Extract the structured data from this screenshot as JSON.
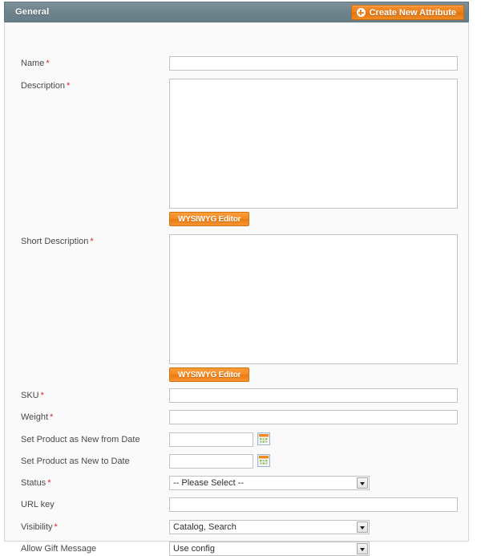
{
  "panel": {
    "title": "General",
    "create_attribute_button": {
      "label": "Create New Attribute",
      "icon": "plus-circle-icon"
    }
  },
  "colors": {
    "header_bg": "#6d838c",
    "accent_orange": "#ed7f1c",
    "required_red": "#d8282b",
    "body_bg": "#fafafa",
    "field_border": "#c2c2c2"
  },
  "fields": {
    "name": {
      "label": "Name",
      "required": "*",
      "value": "",
      "placeholder": ""
    },
    "description": {
      "label": "Description",
      "required": "*",
      "value": "",
      "placeholder": "",
      "editor_button": "WYSIWYG Editor"
    },
    "short_description": {
      "label": "Short Description",
      "required": "*",
      "value": "",
      "placeholder": "",
      "editor_button": "WYSIWYG Editor"
    },
    "sku": {
      "label": "SKU",
      "required": "*",
      "value": "",
      "placeholder": ""
    },
    "weight": {
      "label": "Weight",
      "required": "*",
      "value": "",
      "placeholder": ""
    },
    "new_from_date": {
      "label": "Set Product as New from Date",
      "required": "",
      "value": "",
      "placeholder": "",
      "icon": "calendar-icon"
    },
    "new_to_date": {
      "label": "Set Product as New to Date",
      "required": "",
      "value": "",
      "placeholder": "",
      "icon": "calendar-icon"
    },
    "status": {
      "label": "Status",
      "required": "*",
      "selected": "-- Please Select --"
    },
    "url_key": {
      "label": "URL key",
      "required": "",
      "value": "",
      "placeholder": ""
    },
    "visibility": {
      "label": "Visibility",
      "required": "*",
      "selected": "Catalog, Search"
    },
    "allow_gift_message": {
      "label": "Allow Gift Message",
      "required": "",
      "selected": "Use config"
    }
  }
}
